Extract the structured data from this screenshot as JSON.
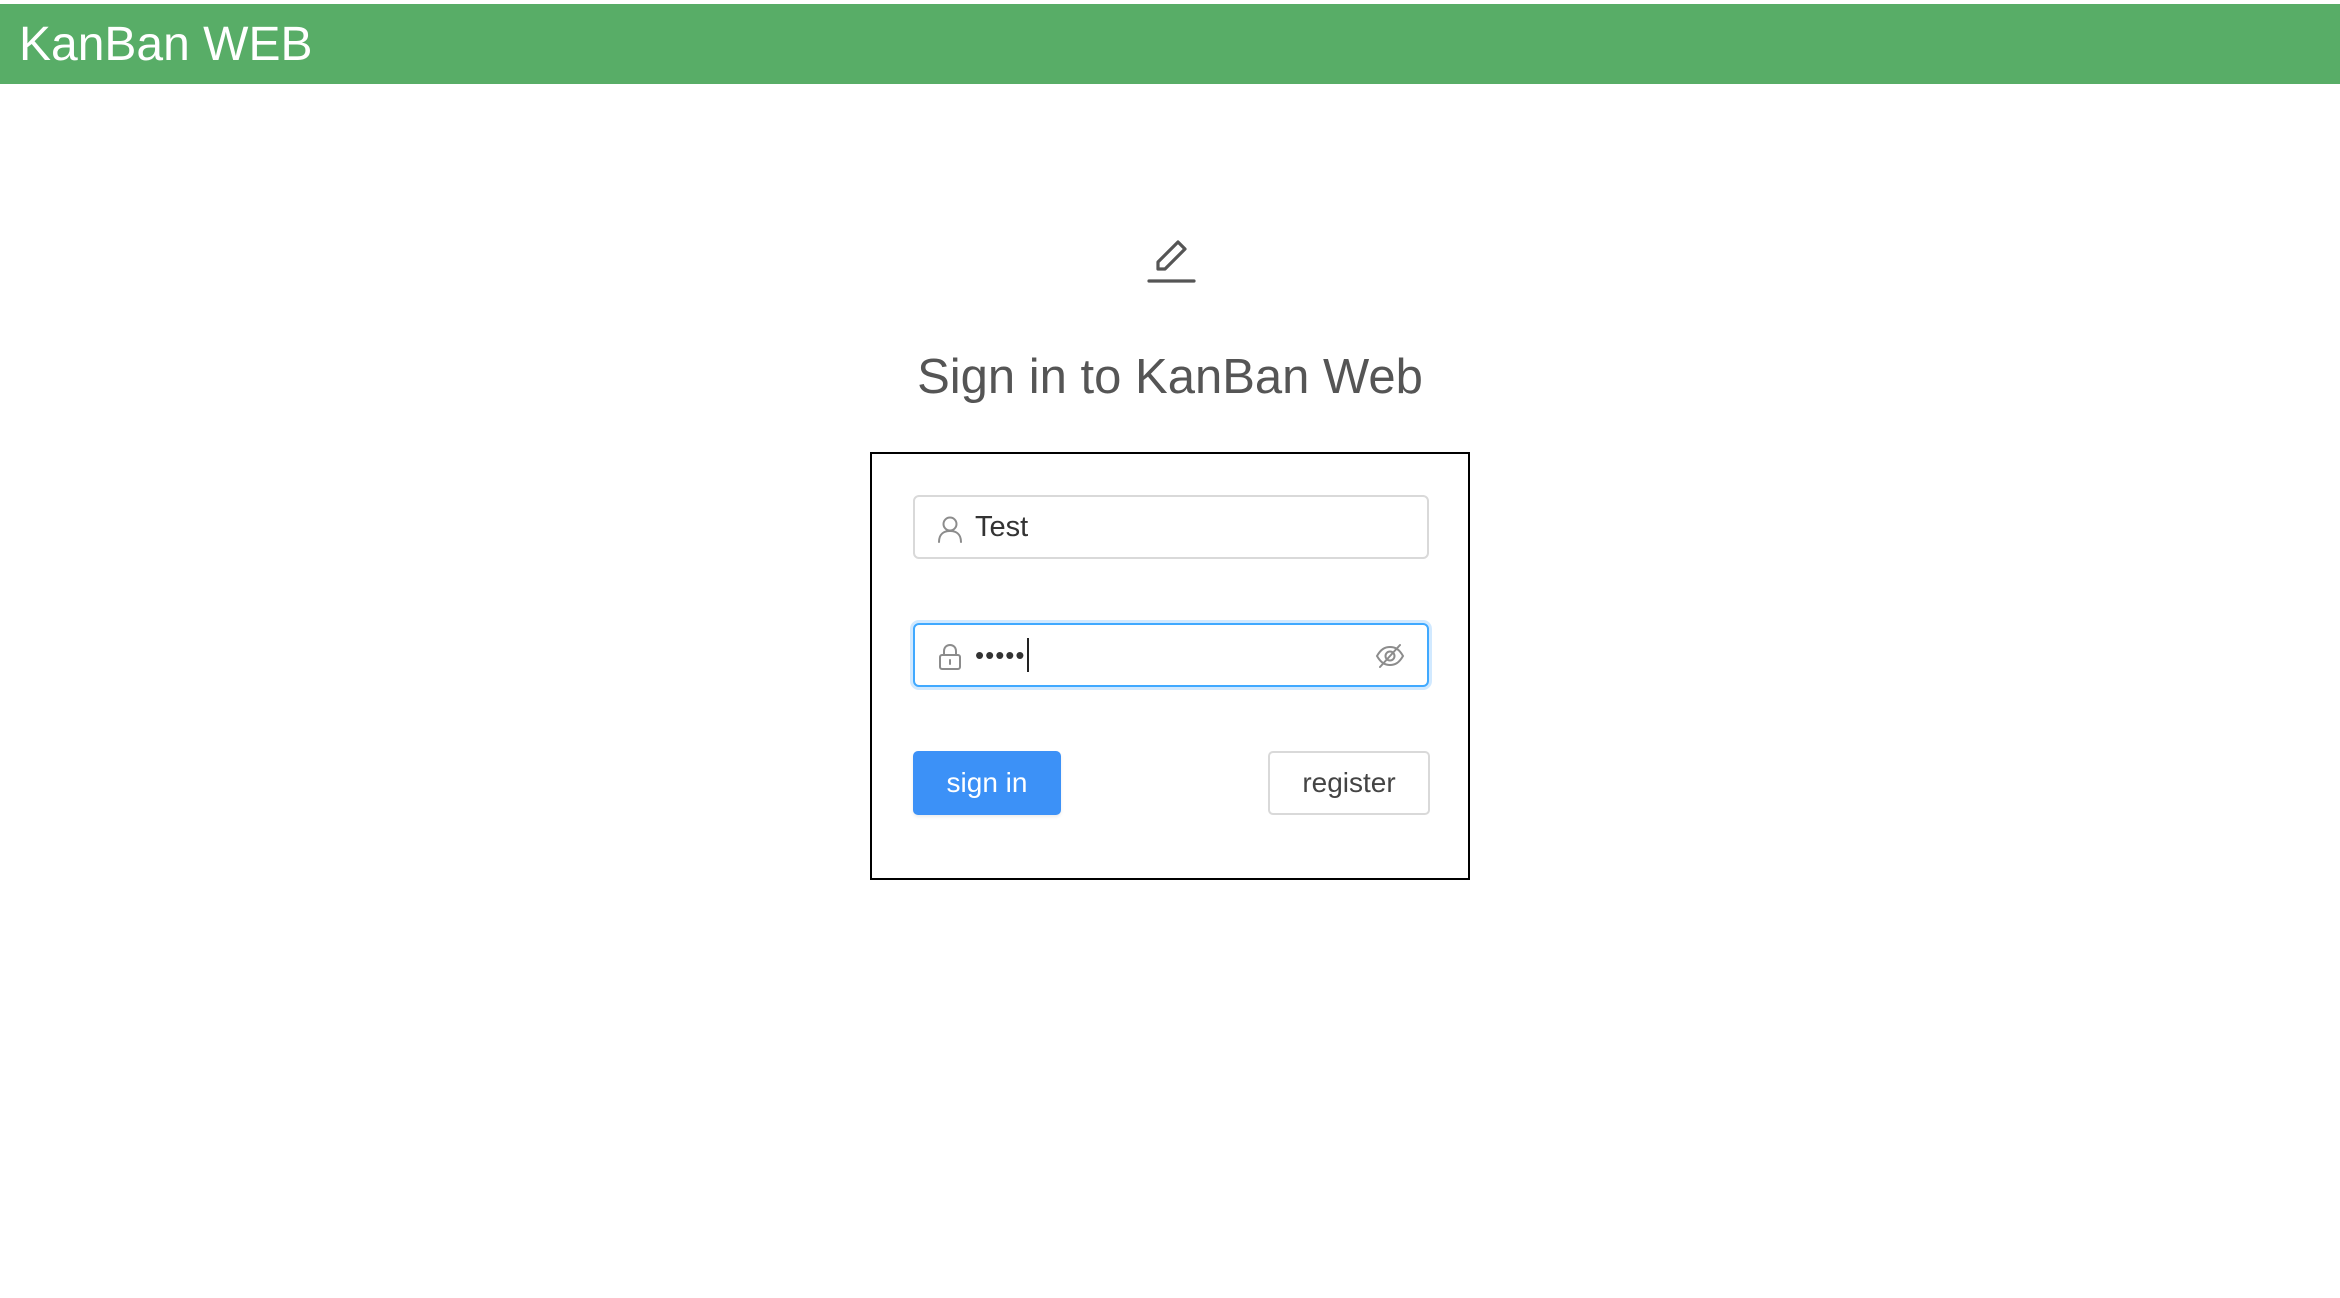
{
  "header": {
    "title": "KanBan WEB",
    "background_color": "#58ad67"
  },
  "page": {
    "icon": "edit-icon",
    "title": "Sign in to KanBan Web"
  },
  "login_form": {
    "username": {
      "icon": "user-icon",
      "value": "Test"
    },
    "password": {
      "icon": "lock-icon",
      "masked_value": "•••••",
      "toggle_icon": "eye-invisible-icon"
    },
    "sign_in_label": "sign in",
    "register_label": "register",
    "primary_color": "#3c91f7"
  }
}
